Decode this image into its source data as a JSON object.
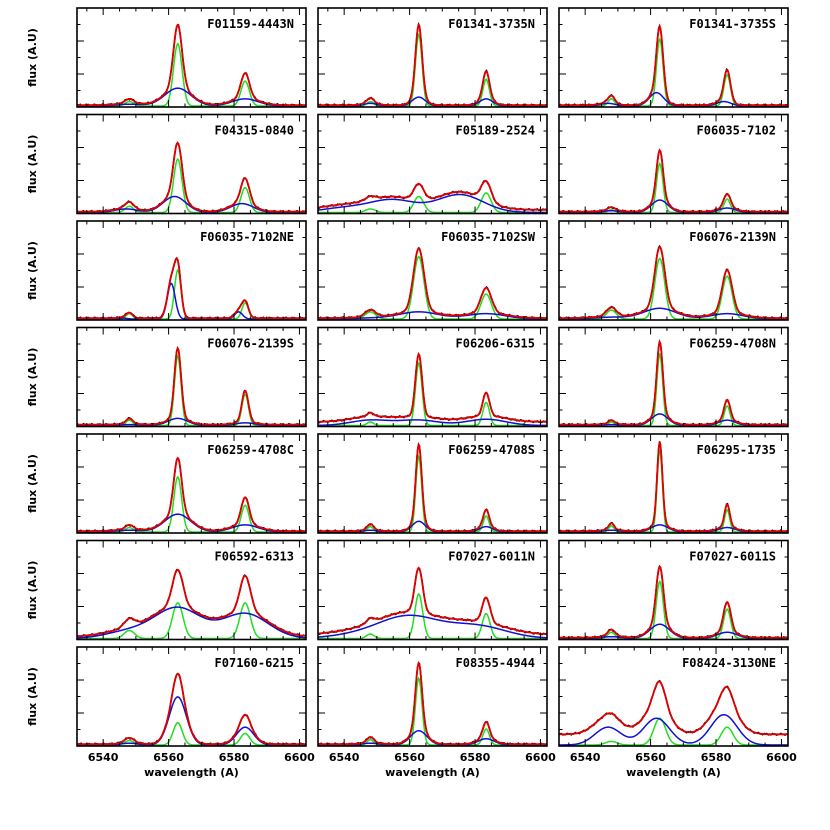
{
  "chart_data": {
    "type": "line",
    "layout": {
      "rows": 7,
      "cols": 3
    },
    "xlabel": "wavelength (A)",
    "ylabel": "flux (A.U)",
    "xlim": [
      6532,
      6602
    ],
    "xticks": [
      6540,
      6560,
      6580,
      6600
    ],
    "colors": {
      "data": "#000000",
      "total_fit": "#e00000",
      "narrow_component": "#22dd22",
      "broad_component": "#1010d0"
    },
    "lines_rest_wavelength": {
      "NII_6548": 6548.0,
      "Halpha": 6562.8,
      "NII_6583": 6583.4
    },
    "panels": [
      {
        "name": "F01159-4443N",
        "n_width": 1.3,
        "b_width": 4.0,
        "b_shift": 0,
        "n_amps": [
          0.05,
          0.7,
          0.28
        ],
        "b_amps": [
          0.02,
          0.2,
          0.08
        ],
        "cont": 0.01
      },
      {
        "name": "F01341-3735N",
        "n_width": 1.0,
        "b_width": 2.0,
        "b_shift": 0,
        "n_amps": [
          0.05,
          0.8,
          0.3
        ],
        "b_amps": [
          0.03,
          0.1,
          0.08
        ],
        "cont": 0.01
      },
      {
        "name": "F01341-3735S",
        "n_width": 1.0,
        "b_width": 2.2,
        "b_shift": -1,
        "n_amps": [
          0.08,
          0.75,
          0.35
        ],
        "b_amps": [
          0.03,
          0.15,
          0.05
        ],
        "cont": 0.01
      },
      {
        "name": "F04315-0840",
        "n_width": 1.3,
        "b_width": 3.5,
        "b_shift": -1,
        "n_amps": [
          0.07,
          0.6,
          0.28
        ],
        "b_amps": [
          0.04,
          0.18,
          0.1
        ],
        "cont": 0.01
      },
      {
        "name": "F05189-2524",
        "n_width": 1.5,
        "b_width": 7.0,
        "b_shift": -8,
        "n_amps": [
          0.04,
          0.18,
          0.22
        ],
        "b_amps": [
          0.05,
          0.14,
          0.2
        ],
        "cont": 0.03
      },
      {
        "name": "F06035-7102",
        "n_width": 1.0,
        "b_width": 2.5,
        "b_shift": 0,
        "n_amps": [
          0.03,
          0.55,
          0.15
        ],
        "b_amps": [
          0.02,
          0.14,
          0.05
        ],
        "cont": 0.01
      },
      {
        "name": "F06035-7102NE",
        "n_width": 1.0,
        "b_width": 1.2,
        "b_shift": -2,
        "n_amps": [
          0.06,
          0.55,
          0.18
        ],
        "b_amps": [
          0.01,
          0.4,
          0.08
        ],
        "cont": 0.01
      },
      {
        "name": "F06035-7102SW",
        "n_width": 1.6,
        "b_width": 6.0,
        "b_shift": 0,
        "n_amps": [
          0.08,
          0.7,
          0.28
        ],
        "b_amps": [
          0.01,
          0.08,
          0.06
        ],
        "cont": 0.01
      },
      {
        "name": "F06076-2139N",
        "n_width": 1.5,
        "b_width": 5.0,
        "b_shift": 0,
        "n_amps": [
          0.1,
          0.68,
          0.48
        ],
        "b_amps": [
          0.02,
          0.12,
          0.06
        ],
        "cont": 0.01
      },
      {
        "name": "F06076-2139S",
        "n_width": 1.0,
        "b_width": 3.0,
        "b_shift": 0,
        "n_amps": [
          0.06,
          0.78,
          0.35
        ],
        "b_amps": [
          0.01,
          0.08,
          0.03
        ],
        "cont": 0.01
      },
      {
        "name": "F06206-6315",
        "n_width": 1.0,
        "b_width": 6.0,
        "b_shift": 0,
        "n_amps": [
          0.04,
          0.7,
          0.26
        ],
        "b_amps": [
          0.06,
          0.06,
          0.07
        ],
        "cont": 0.04
      },
      {
        "name": "F06259-4708N",
        "n_width": 0.9,
        "b_width": 2.5,
        "b_shift": 0,
        "n_amps": [
          0.04,
          0.8,
          0.22
        ],
        "b_amps": [
          0.01,
          0.13,
          0.06
        ],
        "cont": 0.01
      },
      {
        "name": "F06259-4708C",
        "n_width": 1.2,
        "b_width": 4.0,
        "b_shift": 0,
        "n_amps": [
          0.05,
          0.62,
          0.3
        ],
        "b_amps": [
          0.02,
          0.2,
          0.08
        ],
        "cont": 0.01
      },
      {
        "name": "F06259-4708S",
        "n_width": 0.9,
        "b_width": 2.0,
        "b_shift": 0,
        "n_amps": [
          0.06,
          0.85,
          0.18
        ],
        "b_amps": [
          0.02,
          0.12,
          0.06
        ],
        "cont": 0.01
      },
      {
        "name": "F06295-1735",
        "n_width": 0.8,
        "b_width": 2.5,
        "b_shift": 0,
        "n_amps": [
          0.07,
          0.92,
          0.25
        ],
        "b_amps": [
          0.02,
          0.08,
          0.05
        ],
        "cont": 0.01
      },
      {
        "name": "F06592-6313",
        "n_width": 1.6,
        "b_width": 7.0,
        "b_shift": 0,
        "n_amps": [
          0.09,
          0.4,
          0.4
        ],
        "b_amps": [
          0.08,
          0.34,
          0.28
        ],
        "cont": 0.02
      },
      {
        "name": "F07027-6011N",
        "n_width": 1.2,
        "b_width": 9.0,
        "b_shift": -3,
        "n_amps": [
          0.05,
          0.5,
          0.28
        ],
        "b_amps": [
          0.04,
          0.24,
          0.14
        ],
        "cont": 0.04
      },
      {
        "name": "F07027-6011S",
        "n_width": 1.1,
        "b_width": 3.0,
        "b_shift": 0,
        "n_amps": [
          0.07,
          0.64,
          0.33
        ],
        "b_amps": [
          0.02,
          0.16,
          0.07
        ],
        "cont": 0.01
      },
      {
        "name": "F07160-6215",
        "n_width": 1.4,
        "b_width": 2.6,
        "b_shift": 0,
        "n_amps": [
          0.05,
          0.25,
          0.13
        ],
        "b_amps": [
          0.02,
          0.54,
          0.2
        ],
        "cont": 0.01
      },
      {
        "name": "F08355-4944",
        "n_width": 1.0,
        "b_width": 2.5,
        "b_shift": 0,
        "n_amps": [
          0.06,
          0.75,
          0.18
        ],
        "b_amps": [
          0.02,
          0.16,
          0.07
        ],
        "cont": 0.01
      },
      {
        "name": "F08424-3130NE",
        "n_width": 1.8,
        "b_width": 4.0,
        "b_shift": -1,
        "n_amps": [
          0.04,
          0.3,
          0.2
        ],
        "b_amps": [
          0.2,
          0.3,
          0.34
        ],
        "cont": 0.12
      }
    ]
  }
}
